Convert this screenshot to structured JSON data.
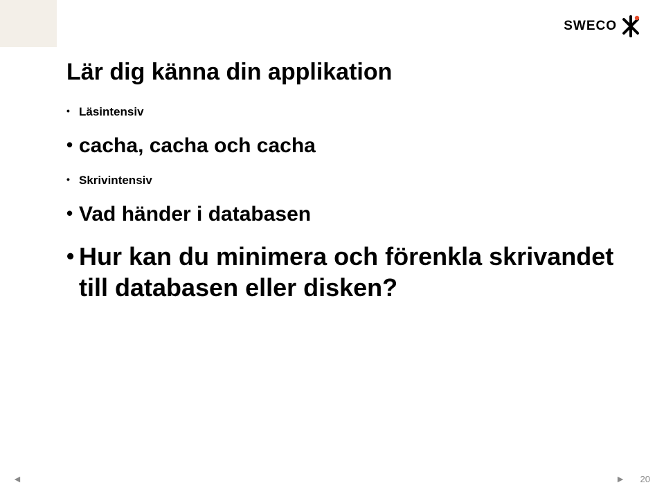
{
  "logo": {
    "text": "SWECO"
  },
  "title": "Lär dig känna din applikation",
  "bullets": [
    {
      "class": "level1-small",
      "text": "Läsintensiv"
    },
    {
      "class": "level2-large",
      "text": "cacha, cacha och cacha"
    },
    {
      "class": "level1-small",
      "text": "Skrivintensiv"
    },
    {
      "class": "level2-large",
      "text": "Vad händer i databasen"
    },
    {
      "class": "level3-xlarge",
      "text": "Hur kan du minimera och förenkla skrivandet till databasen eller disken?"
    }
  ],
  "nav": {
    "prev": "◄",
    "next": "►"
  },
  "page": "20"
}
